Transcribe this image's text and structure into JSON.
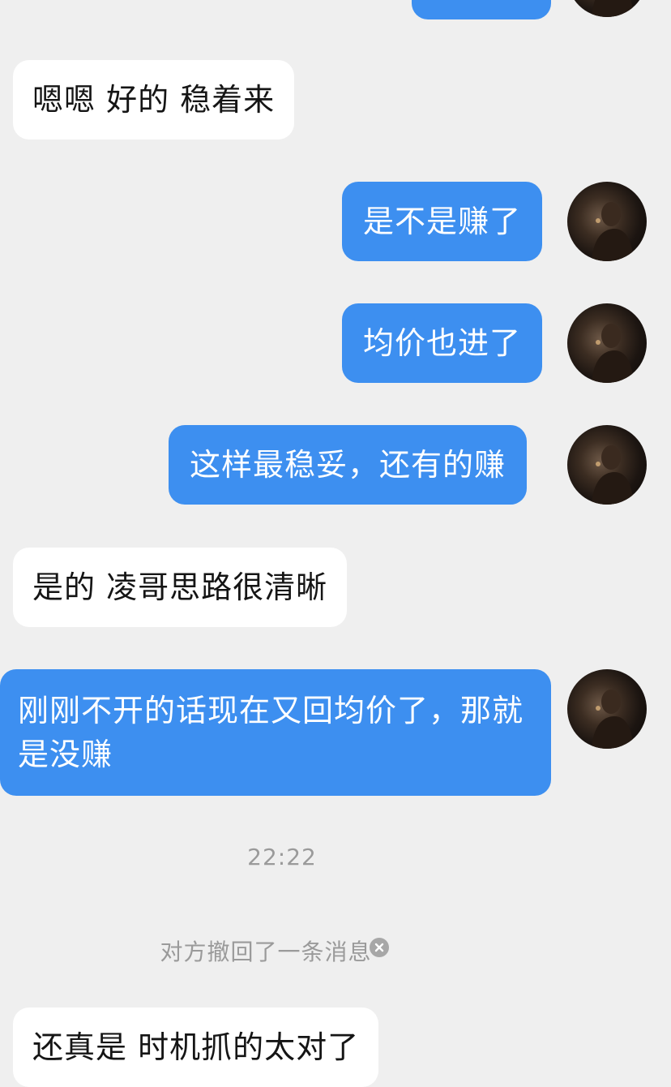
{
  "messages": [
    {
      "id": "m1",
      "direction": "outgoing",
      "text": ""
    },
    {
      "id": "m2",
      "direction": "incoming",
      "text": "嗯嗯 好的  稳着来"
    },
    {
      "id": "m3",
      "direction": "outgoing",
      "text": "是不是赚了"
    },
    {
      "id": "m4",
      "direction": "outgoing",
      "text": "均价也进了"
    },
    {
      "id": "m5",
      "direction": "outgoing",
      "text": "这样最稳妥，还有的赚"
    },
    {
      "id": "m6",
      "direction": "incoming",
      "text": "是的  凌哥思路很清晰"
    },
    {
      "id": "m7",
      "direction": "outgoing",
      "text": "刚刚不开的话现在又回均价了，那就是没赚"
    },
    {
      "id": "m8",
      "direction": "incoming",
      "text": "还真是 时机抓的太对了"
    }
  ],
  "timestamp": "22:22",
  "system_notice": "对方撤回了一条消息",
  "icons": {
    "avatar": "avatar-photo-icon",
    "notice": "close-circle-icon"
  },
  "colors": {
    "outgoing_bubble": "#3d8ff0",
    "incoming_bubble": "#ffffff",
    "background": "#efefef",
    "meta_text": "#9a9a9a"
  }
}
